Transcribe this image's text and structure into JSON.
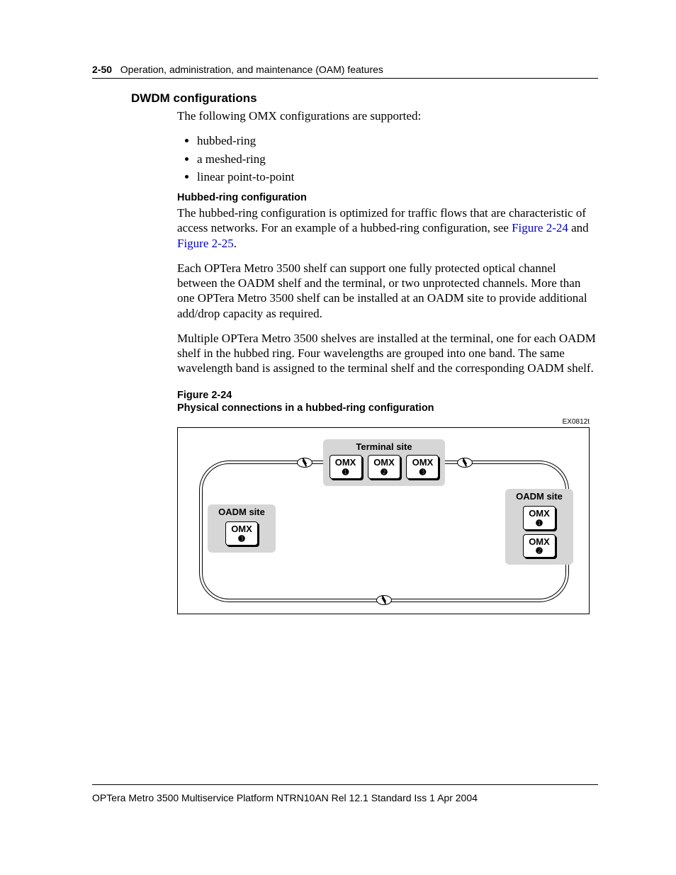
{
  "header": {
    "page_num": "2-50",
    "running_title": "Operation, administration, and maintenance (OAM) features"
  },
  "section": {
    "title": "DWDM configurations",
    "intro": "The following OMX configurations are supported:",
    "bullets": [
      "hubbed-ring",
      "a meshed-ring",
      "linear point-to-point"
    ]
  },
  "hubbed": {
    "heading": "Hubbed-ring configuration",
    "p1a": "The hubbed-ring configuration is optimized for traffic flows that are characteristic of access networks. For an example of a hubbed-ring configuration, see ",
    "link1": "Figure 2-24",
    "p1b": " and ",
    "link2": "Figure 2-25",
    "p1c": ".",
    "p2": "Each OPTera Metro 3500 shelf can support one fully protected optical channel between the OADM shelf and the terminal, or two unprotected channels. More than one OPTera Metro 3500 shelf can be installed at an OADM site to provide additional add/drop capacity as required.",
    "p3": "Multiple OPTera Metro 3500 shelves are installed at the terminal, one for each OADM shelf in the hubbed ring. Four wavelengths are grouped into one band. The same wavelength band is assigned to the terminal shelf and the corresponding OADM shelf."
  },
  "figure": {
    "num": "Figure 2-24",
    "title": "Physical connections in a hubbed-ring configuration",
    "code": "EX0812t",
    "terminal_label": "Terminal site",
    "oadm_label": "OADM site",
    "omx": "OMX",
    "n1": "➊",
    "n2": "➋",
    "n3": "➌"
  },
  "footer": {
    "text": "OPTera Metro 3500 Multiservice Platform   NTRN10AN   Rel 12.1   Standard   Iss 1   Apr 2004"
  }
}
